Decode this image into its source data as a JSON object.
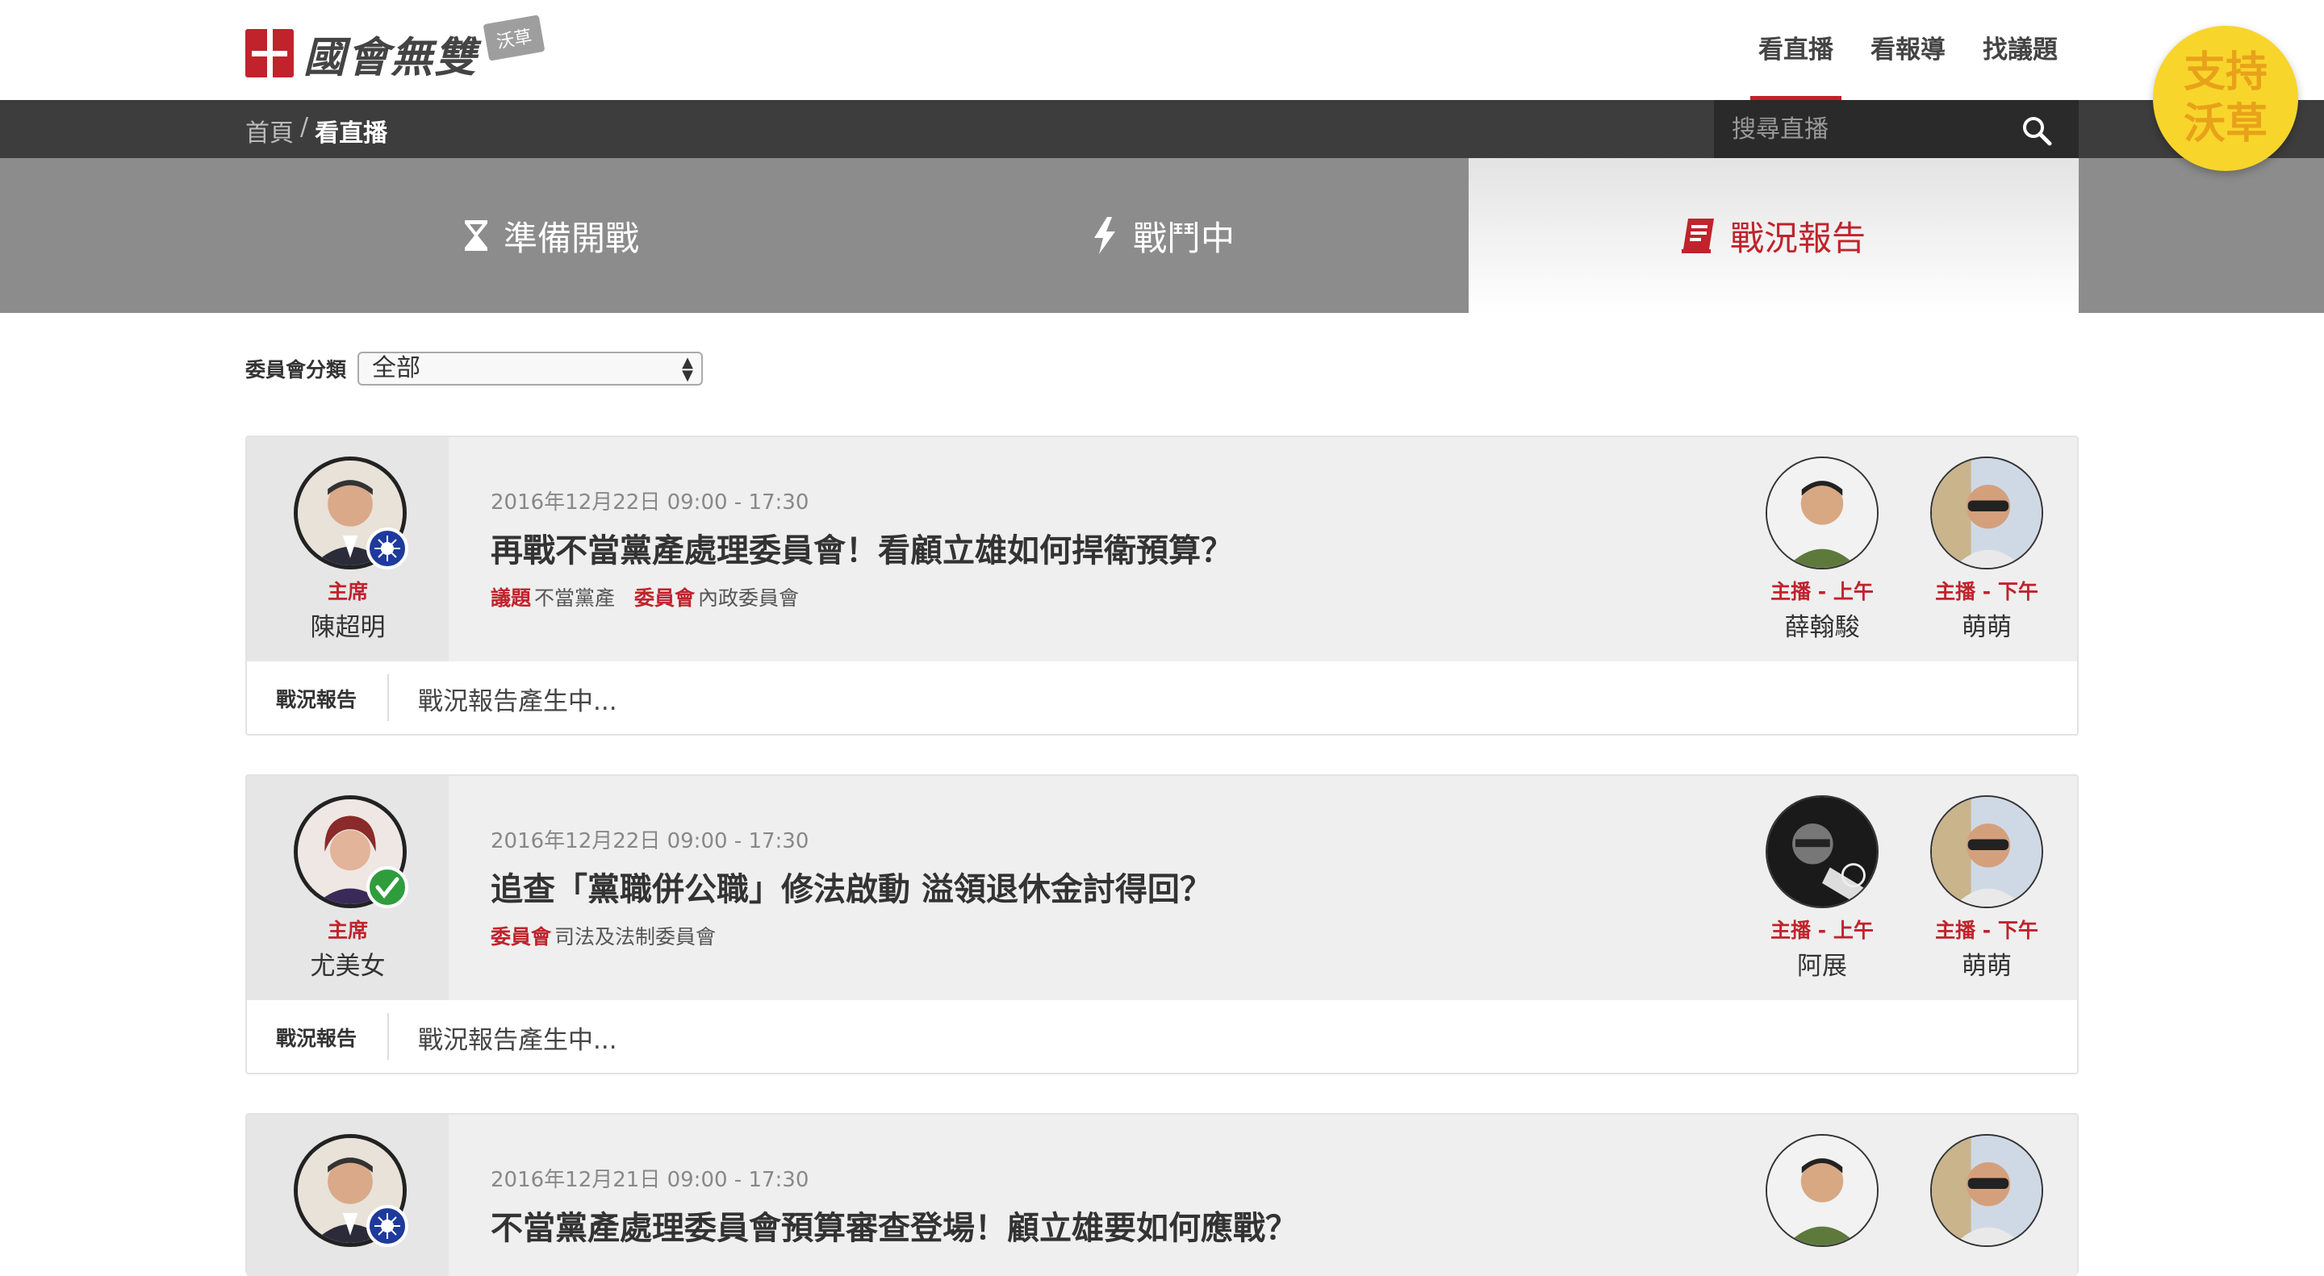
{
  "header": {
    "logo_text": "國會無雙",
    "logo_tag": "沃草",
    "nav": [
      "看直播",
      "看報導",
      "找議題"
    ],
    "support": [
      "支持",
      "沃草"
    ]
  },
  "breadcrumb": {
    "home": "首頁",
    "sep": "/",
    "current": "看直播"
  },
  "search": {
    "placeholder": "搜尋直播"
  },
  "tabs": [
    {
      "label": "準備開戰",
      "icon": "hourglass-icon"
    },
    {
      "label": "戰鬥中",
      "icon": "lightning-icon"
    },
    {
      "label": "戰況報告",
      "icon": "report-icon"
    }
  ],
  "filter": {
    "label": "委員會分類",
    "value": "全部"
  },
  "cards": [
    {
      "chair_role": "主席",
      "chair_name": "陳超明",
      "party": "kmt",
      "date": "2016年12月22日 09:00 - 17:30",
      "title": "再戰不當黨產處理委員會！看顧立雄如何捍衛預算？",
      "tag1_key": "議題",
      "tag1_val": "不當黨產",
      "tag2_key": "委員會",
      "tag2_val": "內政委員會",
      "host1_role": "主播 - 上午",
      "host1_name": "薛翰駿",
      "host2_role": "主播 - 下午",
      "host2_name": "萌萌",
      "report_label": "戰況報告",
      "report_text": "戰況報告產生中..."
    },
    {
      "chair_role": "主席",
      "chair_name": "尤美女",
      "party": "dpp",
      "date": "2016年12月22日 09:00 - 17:30",
      "title": "追查「黨職併公職」修法啟動 溢領退休金討得回？",
      "tag2_key": "委員會",
      "tag2_val": "司法及法制委員會",
      "host1_role": "主播 - 上午",
      "host1_name": "阿展",
      "host2_role": "主播 - 下午",
      "host2_name": "萌萌",
      "report_label": "戰況報告",
      "report_text": "戰況報告產生中..."
    },
    {
      "date": "2016年12月21日 09:00 - 17:30",
      "title": "不當黨產處理委員會預算審查登場！顧立雄要如何應戰？"
    }
  ]
}
